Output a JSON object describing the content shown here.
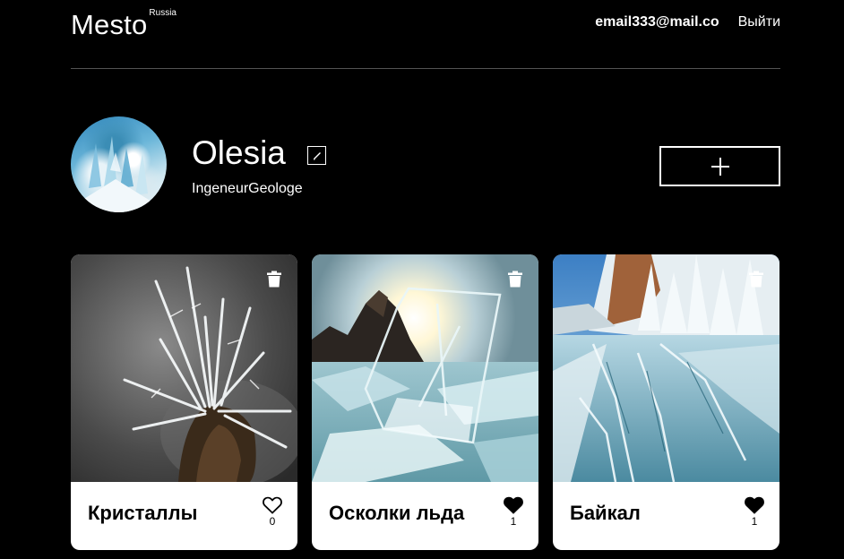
{
  "colors": {
    "background": "#000000",
    "text": "#ffffff",
    "card_background": "#ffffff",
    "card_text": "#000000",
    "divider": "#545454"
  },
  "header": {
    "logo": "Mesto",
    "logo_sup": "Russia",
    "email": "email333@mail.co",
    "logout": "Выйти"
  },
  "profile": {
    "name": "Olesia",
    "about": "IngeneurGeologe",
    "avatar_icon": "avatar-image",
    "edit_icon": "pencil-icon",
    "add_icon": "plus-icon"
  },
  "cards": [
    {
      "title": "Кристаллы",
      "likes": "0",
      "liked": false,
      "image_icon": "crystals-photo"
    },
    {
      "title": "Осколки льда",
      "likes": "1",
      "liked": true,
      "image_icon": "ice-shards-photo"
    },
    {
      "title": "Байкал",
      "likes": "1",
      "liked": true,
      "image_icon": "baikal-photo"
    }
  ]
}
